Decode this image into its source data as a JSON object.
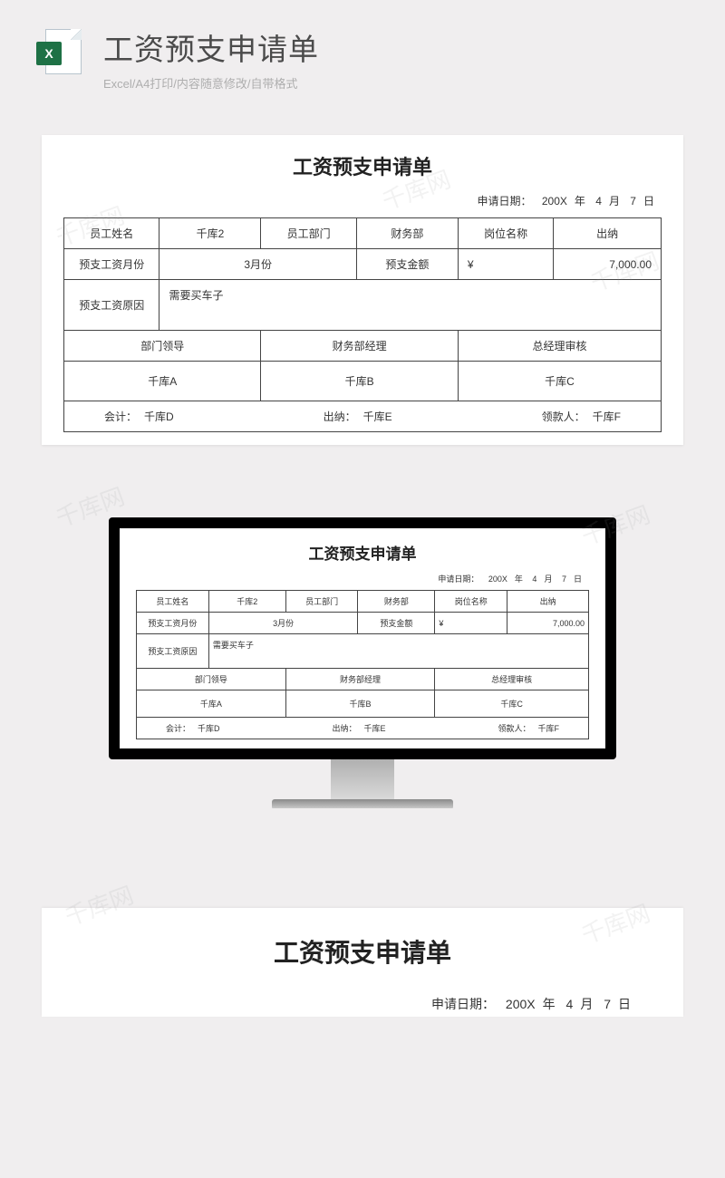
{
  "header": {
    "title": "工资预支申请单",
    "subtitle": "Excel/A4打印/内容随意修改/自带格式",
    "icon_letter": "X"
  },
  "form": {
    "title": "工资预支申请单",
    "date_label": "申请日期：",
    "year": "200X",
    "year_unit": "年",
    "month": "4",
    "month_unit": "月",
    "day": "7",
    "day_unit": "日",
    "labels": {
      "emp_name": "员工姓名",
      "emp_dept": "员工部门",
      "position": "岗位名称",
      "advance_month": "预支工资月份",
      "advance_amount": "预支金额",
      "reason": "预支工资原因",
      "dept_leader": "部门领导",
      "finance_mgr": "财务部经理",
      "gm_review": "总经理审核"
    },
    "values": {
      "emp_name": "千库2",
      "emp_dept": "财务部",
      "position": "出纳",
      "advance_month": "3月份",
      "currency": "¥",
      "advance_amount": "7,000.00",
      "reason": "需要买车子",
      "dept_leader": "千库A",
      "finance_mgr": "千库B",
      "gm_review": "千库C"
    },
    "footer": {
      "accountant_label": "会计：",
      "accountant": "千库D",
      "cashier_label": "出纳：",
      "cashier": "千库E",
      "receiver_label": "领款人：",
      "receiver": "千库F"
    }
  },
  "watermark": "千库网"
}
